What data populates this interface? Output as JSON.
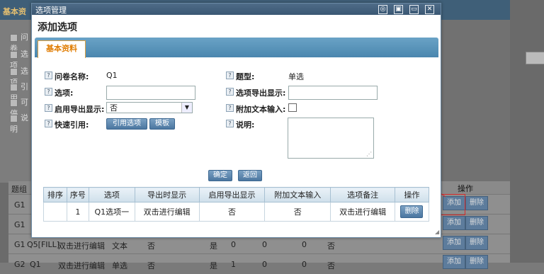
{
  "background": {
    "header_title": "基本资",
    "side_rows": [
      "问卷",
      "选项",
      "选项",
      "引用",
      "可停",
      "说明"
    ],
    "right_op_header": "操作",
    "table_header_left": "题组",
    "rows": [
      {
        "col1": "G1",
        "add": "添加",
        "del": "删除"
      },
      {
        "col1": "G1",
        "add": "添加",
        "del": "删除"
      },
      {
        "col1": "G1",
        "col2": "Q5[FILL]",
        "col3": "双击进行编辑",
        "col4": "文本",
        "col5": "否",
        "col6": "是",
        "col7": "0",
        "col8": "0",
        "col9": "0",
        "col10": "否",
        "add": "添加",
        "del": "删除"
      },
      {
        "col1": "G2",
        "col2": "Q1",
        "col3": "双击进行编辑",
        "col4": "单选",
        "col5": "否",
        "col6": "是",
        "col7": "1",
        "col8": "0",
        "col9": "0",
        "col10": "否",
        "add": "添加",
        "del": "删除"
      }
    ]
  },
  "dialog": {
    "window_title": "选项管理",
    "heading": "添加选项",
    "tab_label": "基本资料",
    "fields": {
      "questionnaire_name_label": "问卷名称:",
      "questionnaire_name_value": "Q1",
      "question_type_label": "题型:",
      "question_type_value": "单选",
      "option_label": "选项:",
      "option_value": "",
      "option_export_label": "选项导出显示:",
      "option_export_value": "",
      "enable_export_label": "启用导出显示:",
      "enable_export_value": "否",
      "extra_text_label": "附加文本输入:",
      "quick_ref_label": "快速引用:",
      "ref_option_button": "引用选项",
      "template_button": "模板",
      "description_label": "说明:"
    },
    "confirm_button": "确定",
    "back_button": "返回",
    "table": {
      "headers": [
        "排序",
        "序号",
        "选项",
        "导出时显示",
        "启用导出显示",
        "附加文本输入",
        "选项备注",
        "操作"
      ],
      "rows": [
        {
          "sort": "",
          "index": "1",
          "option": "Q1选项一",
          "export": "双击进行编辑",
          "enable": "否",
          "extra": "否",
          "note": "双击进行编辑",
          "action": "删除"
        }
      ]
    }
  }
}
